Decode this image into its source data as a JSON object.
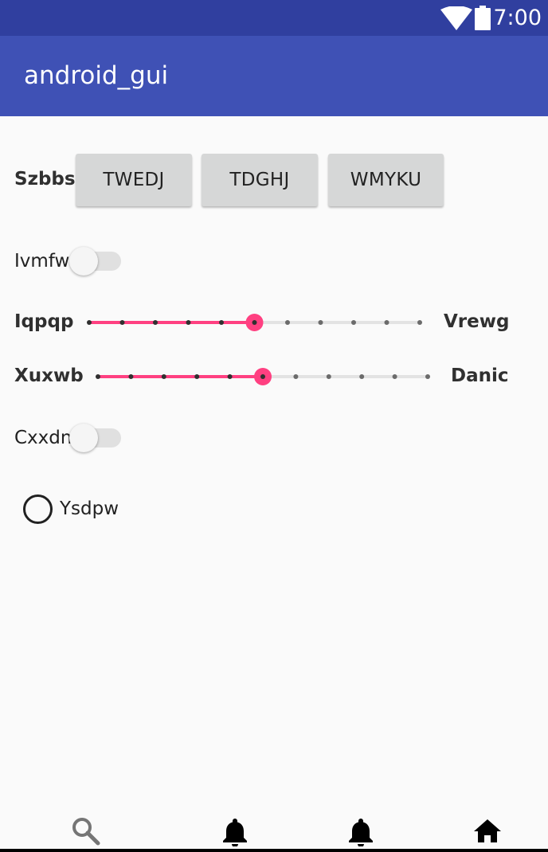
{
  "status_bar": {
    "time": "7:00",
    "icons": [
      "wifi-icon",
      "battery-icon"
    ]
  },
  "app_bar": {
    "title": "android_gui"
  },
  "button_row": {
    "label": "Szbbs",
    "buttons": [
      "TWEDJ",
      "TDGHJ",
      "WMYKU"
    ]
  },
  "switch_1": {
    "label": "Ivmfw",
    "checked": false
  },
  "slider_1": {
    "left_label": "Iqpqp",
    "right_label": "Vrewg",
    "steps": 10,
    "value": 5
  },
  "slider_2": {
    "left_label": "Xuxwb",
    "right_label": "Danic",
    "steps": 10,
    "value": 5
  },
  "switch_2": {
    "label": "Cxxdn",
    "checked": false
  },
  "radio": {
    "label": "Ysdpw",
    "checked": false
  },
  "bottom_nav": {
    "items": [
      "search-icon",
      "bell-icon",
      "bell-icon",
      "home-icon"
    ]
  },
  "colors": {
    "primary": "#3f51b5",
    "primary_dark": "#303f9f",
    "accent": "#ff4081",
    "background": "#fafafa"
  }
}
